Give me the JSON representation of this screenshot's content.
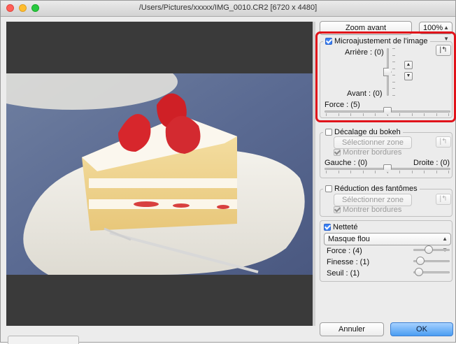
{
  "window": {
    "title": "/Users/Pictures/xxxxx/IMG_0010.CR2 [6720 x 4480]"
  },
  "toolbar": {
    "zoom_in_label": "Zoom avant",
    "zoom_level": "100%"
  },
  "microadjust": {
    "label": "Microajustement de l'image",
    "checked": true,
    "back_label": "Arrière : (0)",
    "front_label": "Avant : (0)",
    "force_label": "Force : (5)",
    "back_value": 0,
    "front_value": 0,
    "force_value": 5
  },
  "bokeh_shift": {
    "label": "Décalage du bokeh",
    "checked": false,
    "select_area_label": "Sélectionner zone",
    "show_borders_label": "Montrer bordures",
    "left_label": "Gauche : (0)",
    "right_label": "Droite : (0)"
  },
  "ghost_reduction": {
    "label": "Réduction des fantômes",
    "checked": false,
    "select_area_label": "Sélectionner zone",
    "show_borders_label": "Montrer bordures"
  },
  "sharpness": {
    "label": "Netteté",
    "checked": true,
    "mode": "Masque flou",
    "strength_label": "Force : (4)",
    "fineness_label": "Finesse : (1)",
    "threshold_label": "Seuil : (1)",
    "strength_value": 4,
    "fineness_value": 1,
    "threshold_value": 1
  },
  "footer": {
    "cancel_label": "Annuler",
    "ok_label": "OK"
  },
  "colors": {
    "highlight": "#e0131a",
    "ok_button": "#4a9df2"
  },
  "icons": {
    "reset": "reset-icon",
    "up": "chevron-up-icon",
    "down": "chevron-down-icon"
  }
}
